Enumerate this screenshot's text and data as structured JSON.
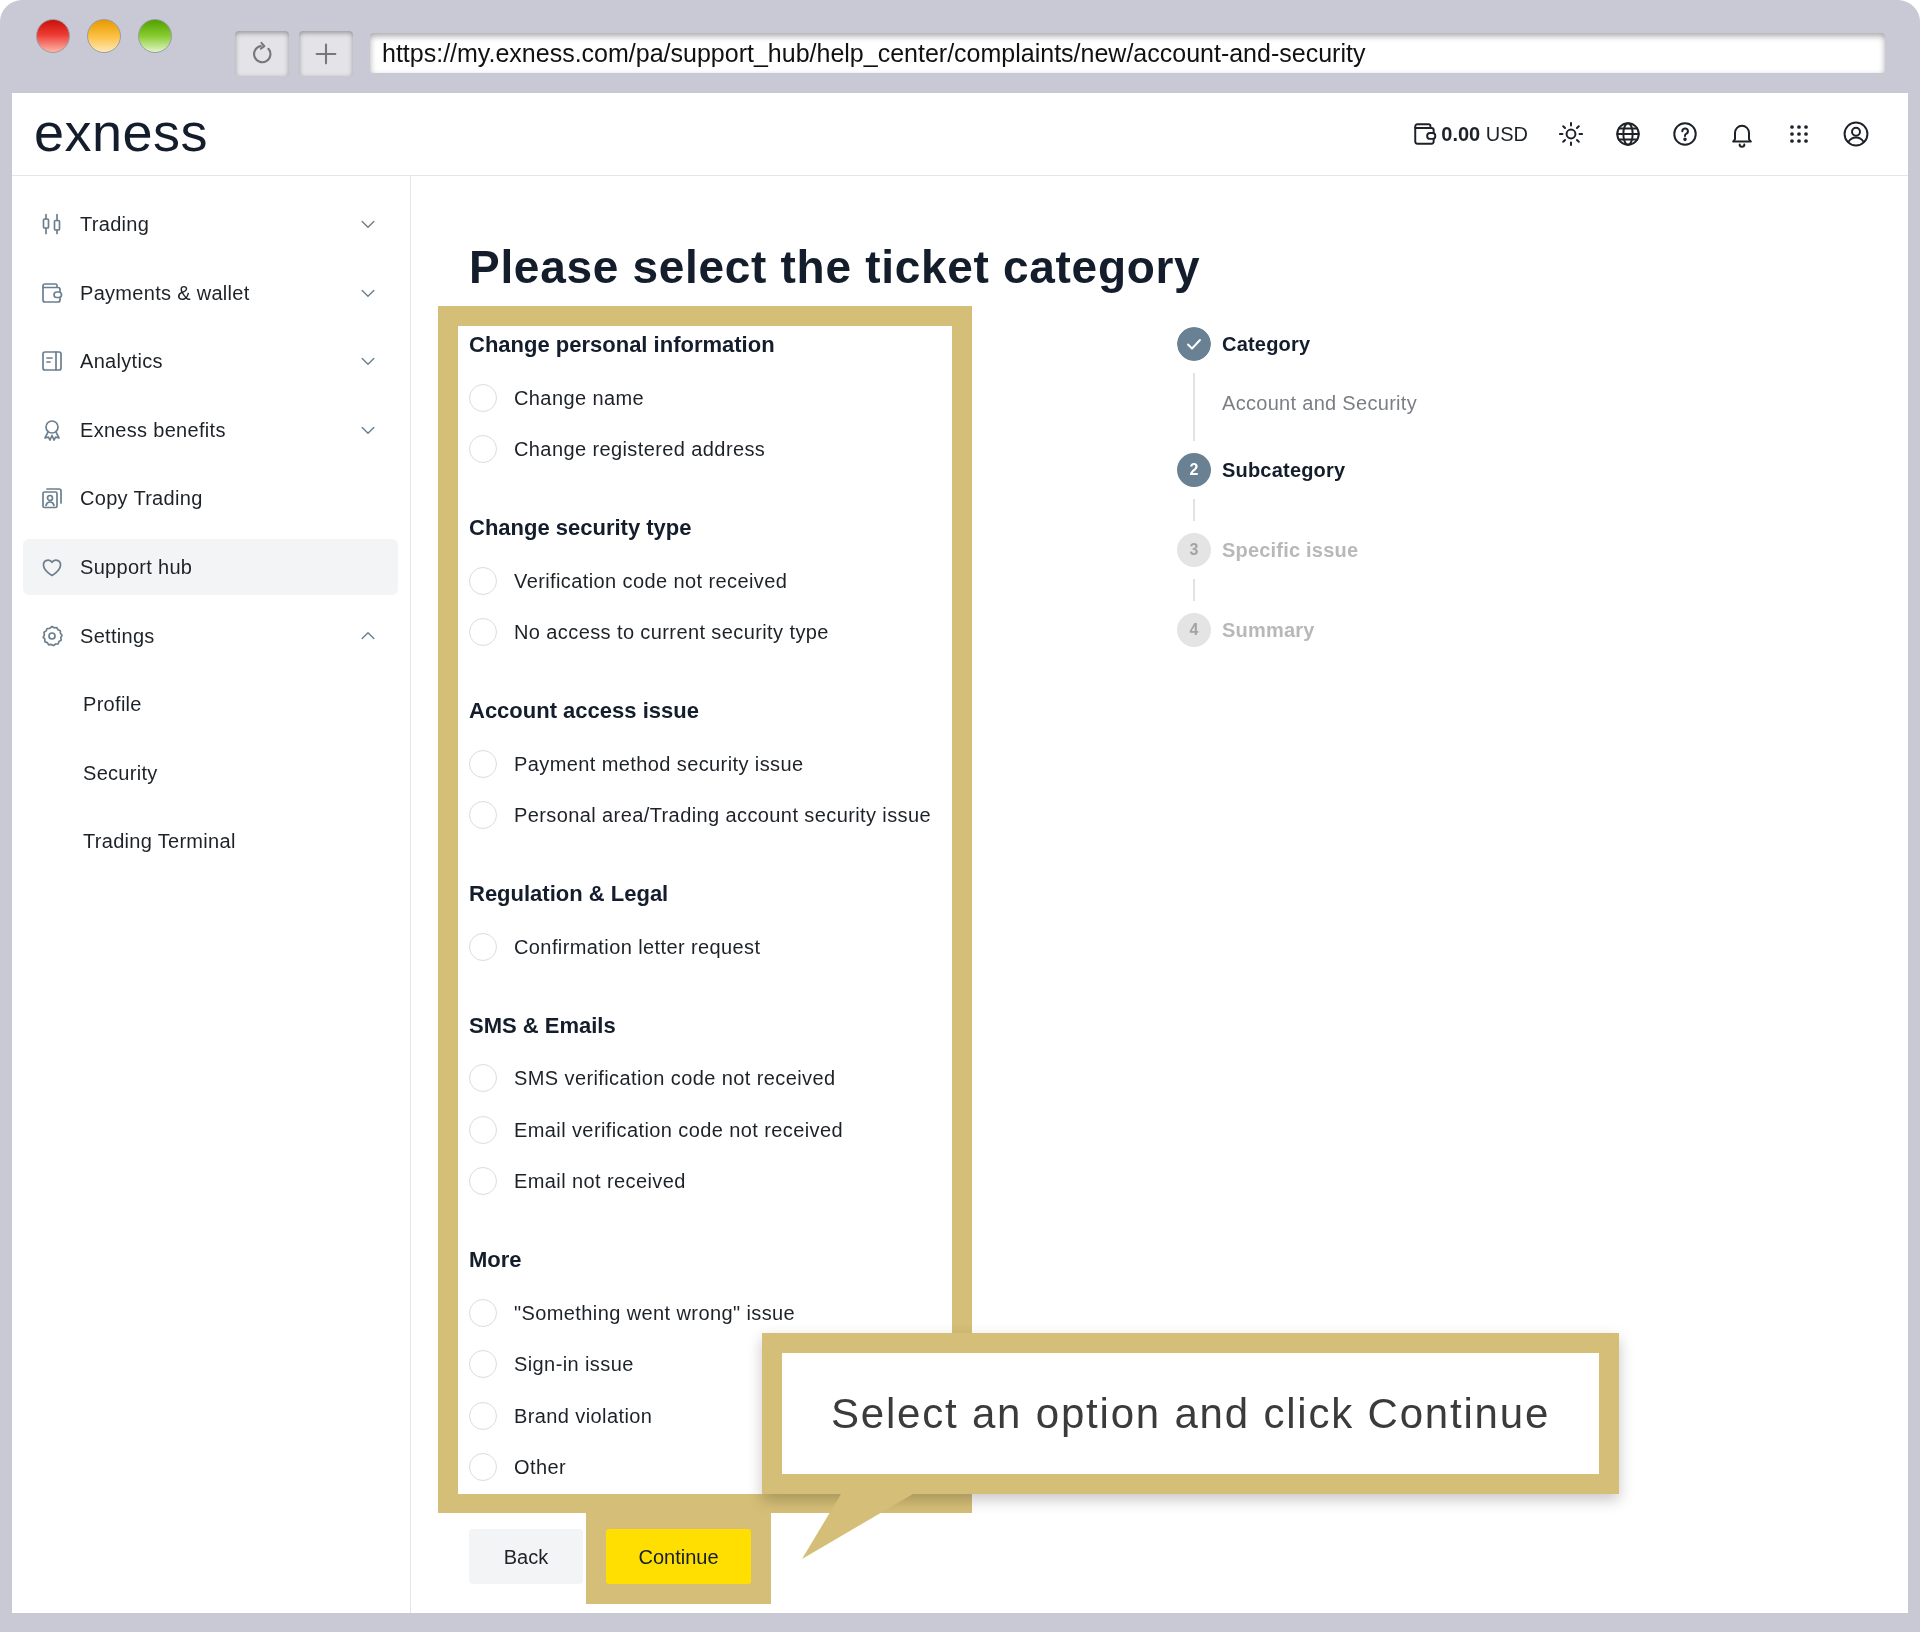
{
  "browser": {
    "url": "https://my.exness.com/pa/support_hub/help_center/complaints/new/account-and-security"
  },
  "header": {
    "logo": "exness",
    "balance": "**0.00** USD"
  },
  "sidebar": {
    "items": [
      {
        "label": "Trading",
        "selected": false,
        "expanded": false
      },
      {
        "label": "Payments & wallet",
        "selected": false,
        "expanded": false
      },
      {
        "label": "Analytics",
        "selected": false,
        "expanded": false
      },
      {
        "label": "Exness benefits",
        "selected": false,
        "expanded": false
      },
      {
        "label": "Copy Trading",
        "selected": false
      },
      {
        "label": "Support hub",
        "selected": true
      },
      {
        "label": "Settings",
        "selected": false,
        "expanded": true,
        "children": [
          {
            "label": "Profile",
            "selected": false
          },
          {
            "label": "Security",
            "selected": false
          },
          {
            "label": "Trading Terminal",
            "selected": false
          }
        ]
      }
    ]
  },
  "page": {
    "title": "Please select the ticket category"
  },
  "categories": {
    "highlighted": true,
    "groups": [
      {
        "heading": "Change personal information",
        "options": [
          {
            "label": "Change name",
            "selected": false
          },
          {
            "label": "Change registered address",
            "selected": false
          }
        ]
      },
      {
        "heading": "Change security type",
        "options": [
          {
            "label": "Verification code not received",
            "selected": false
          },
          {
            "label": "No access to current security type",
            "selected": false
          }
        ]
      },
      {
        "heading": "Account access issue",
        "options": [
          {
            "label": "Payment method security issue",
            "selected": false
          },
          {
            "label": "Personal area/Trading account security issue",
            "selected": false
          }
        ]
      },
      {
        "heading": "Regulation & Legal",
        "options": [
          {
            "label": "Confirmation letter request",
            "selected": false
          }
        ]
      },
      {
        "heading": "SMS & Emails",
        "options": [
          {
            "label": "SMS verification code not received",
            "selected": false
          },
          {
            "label": "Email verification code not received",
            "selected": false
          },
          {
            "label": "Email not received",
            "selected": false
          }
        ]
      },
      {
        "heading": "More",
        "options": [
          {
            "label": "\"Something went wrong\" issue",
            "selected": false
          },
          {
            "label": "Sign-in issue",
            "selected": false
          },
          {
            "label": "Brand violation",
            "selected": false
          },
          {
            "label": "Other",
            "selected": false
          }
        ]
      }
    ]
  },
  "buttons": [
    {
      "label": "Back",
      "kind": "secondary"
    },
    {
      "label": "Continue",
      "kind": "primary",
      "highlighted": true
    }
  ],
  "stepper": {
    "steps": [
      {
        "label": "Category",
        "completed": true,
        "selected": false,
        "detail": "Account and Security"
      },
      {
        "number": "2",
        "label": "Subcategory",
        "completed": false,
        "selected": true
      },
      {
        "number": "3",
        "label": "Specific issue",
        "completed": false,
        "selected": false
      },
      {
        "number": "4",
        "label": "Summary",
        "completed": false,
        "selected": false
      }
    ]
  },
  "callout": {
    "text": "Select an option and click Continue"
  }
}
